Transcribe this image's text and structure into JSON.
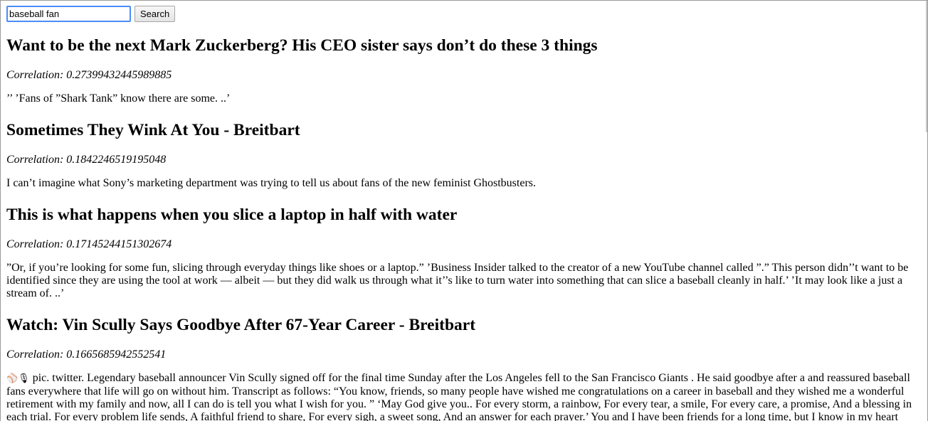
{
  "search": {
    "value": "baseball fan",
    "button_label": "Search"
  },
  "results": [
    {
      "title": "Want to be the next Mark Zuckerberg? His CEO sister says don’t do these 3 things",
      "correlation": "Correlation: 0.27399432445989885",
      "snippet": "’’ ’Fans of ”Shark Tank” know there are some. ..’"
    },
    {
      "title": "Sometimes They Wink At You - Breitbart",
      "correlation": "Correlation: 0.1842246519195048",
      "snippet": "I can’t imagine what Sony’s marketing department was trying to tell us about fans of the new feminist Ghostbusters."
    },
    {
      "title": "This is what happens when you slice a laptop in half with water",
      "correlation": "Correlation: 0.17145244151302674",
      "snippet": "”Or, if you’re looking for some fun, slicing through everyday things like shoes or a laptop.” ’Business Insider talked to the creator of a new YouTube channel called ”.” This person didn’’t want to be identified since they are using the tool at work — albeit — but they did walk us through what it’’s like to turn water into something that can slice a baseball cleanly in half.’ ’It may look like a just a stream of. ..’"
    },
    {
      "title": "Watch: Vin Scully Says Goodbye After 67-Year Career - Breitbart",
      "correlation": "Correlation: 0.1665685942552541",
      "snippet_glyphs": "⚾🎙",
      "snippet": " pic. twitter. Legendary baseball announcer Vin Scully signed off for the final time Sunday after the Los Angeles fell to the San Francisco Giants . He said goodbye after a and reassured baseball fans everywhere that life will go on without him. Transcript as follows: “You know, friends, so many people have wished me congratulations on a career in baseball and they wished me a wonderful retirement with my family and now, all I can do is tell you what I wish for you. ” ‘May God give you.. For every storm, a rainbow, For every tear, a smile, For every care, a promise, And a blessing in each trial. For every problem life sends, A faithful friend to share, For every sigh, a sweet song, And an answer for each prayer.’ You and I have been friends for a long time, but I know in my heart"
    }
  ]
}
